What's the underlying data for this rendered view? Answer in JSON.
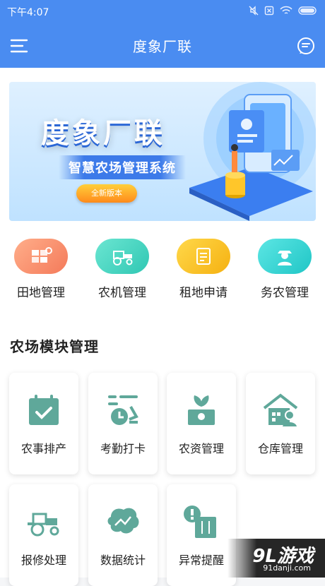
{
  "status_bar": {
    "time": "下午4:07"
  },
  "header": {
    "title": "度象厂联"
  },
  "banner": {
    "headline": "度象厂联",
    "subtitle": "智慧农场管理系统",
    "badge": "全新版本"
  },
  "quick_actions": [
    {
      "label": "田地管理",
      "icon": "field-icon",
      "color": "#f7906c"
    },
    {
      "label": "农机管理",
      "icon": "tractor-icon",
      "color": "#45d6c3"
    },
    {
      "label": "租地申请",
      "icon": "lease-icon",
      "color": "#f9c62d"
    },
    {
      "label": "务农管理",
      "icon": "farmer-icon",
      "color": "#3dd5d4"
    }
  ],
  "section": {
    "title": "农场模块管理"
  },
  "modules": [
    {
      "label": "农事排产",
      "icon": "calendar-check-icon"
    },
    {
      "label": "考勤打卡",
      "icon": "clock-in-icon"
    },
    {
      "label": "农资管理",
      "icon": "farm-supplies-icon"
    },
    {
      "label": "仓库管理",
      "icon": "warehouse-icon"
    },
    {
      "label": "报修处理",
      "icon": "tractor-repair-icon"
    },
    {
      "label": "数据统计",
      "icon": "statistics-icon"
    },
    {
      "label": "异常提醒",
      "icon": "alert-icon"
    }
  ],
  "watermark": {
    "logo": "9L游戏",
    "url": "91danji.com"
  },
  "colors": {
    "primary": "#4a8cf1",
    "module_icon": "#5fa89a"
  }
}
